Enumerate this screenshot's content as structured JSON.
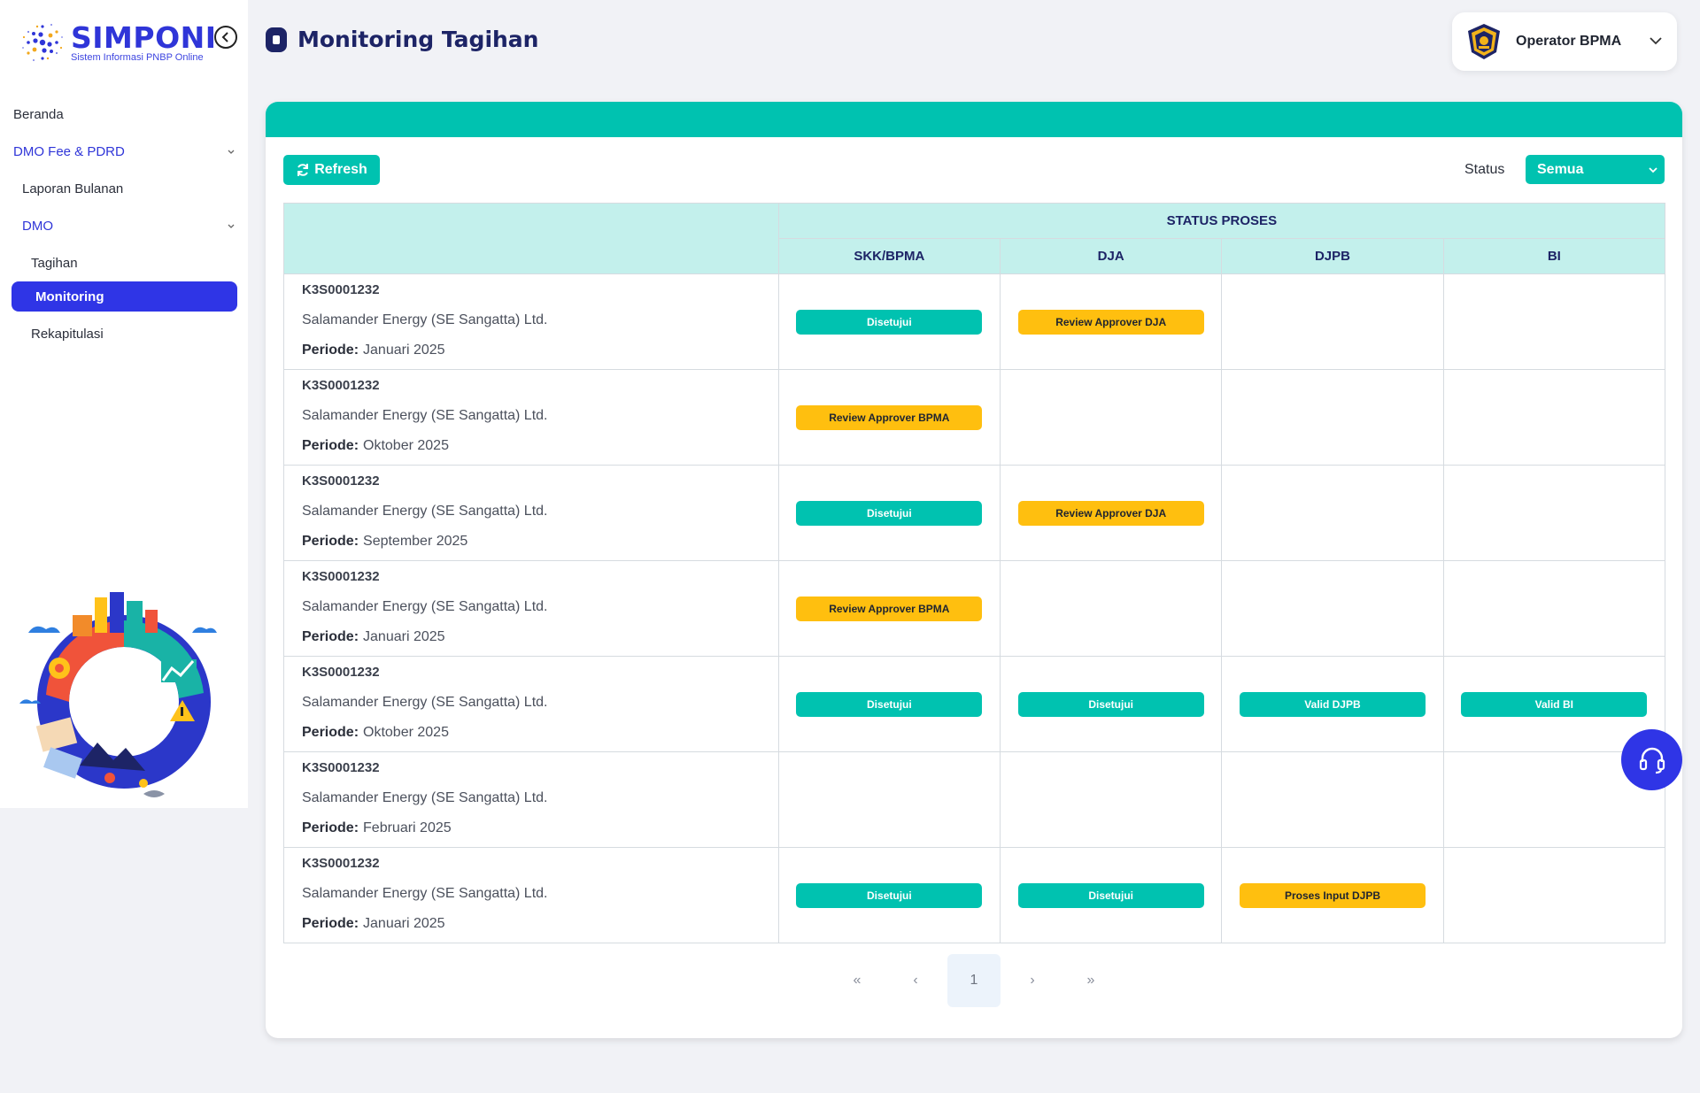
{
  "app": {
    "name": "SIMPONI",
    "tagline": "Sistem Informasi PNBP Online"
  },
  "sidebar": {
    "items": [
      {
        "label": "Beranda"
      },
      {
        "label": "DMO Fee & PDRD"
      },
      {
        "label": "Laporan Bulanan"
      },
      {
        "label": "DMO"
      },
      {
        "label": "Tagihan"
      },
      {
        "label": "Monitoring"
      },
      {
        "label": "Rekapitulasi"
      }
    ]
  },
  "header": {
    "title": "Monitoring Tagihan",
    "user": "Operator BPMA"
  },
  "toolbar": {
    "refresh_label": "Refresh",
    "status_label": "Status",
    "status_value": "Semua"
  },
  "table": {
    "group_header": "STATUS PROSES",
    "columns": [
      "SKK/BPMA",
      "DJA",
      "DJPB",
      "BI"
    ],
    "period_label": "Periode:",
    "rows": [
      {
        "code": "K3S0001232",
        "company": "Salamander Energy (SE Sangatta) Ltd.",
        "period": "Januari 2025",
        "statuses": [
          {
            "text": "Disetujui",
            "color": "green"
          },
          {
            "text": "Review Approver DJA",
            "color": "yellow"
          },
          null,
          null
        ]
      },
      {
        "code": "K3S0001232",
        "company": "Salamander Energy (SE Sangatta) Ltd.",
        "period": "Oktober 2025",
        "statuses": [
          {
            "text": "Review Approver BPMA",
            "color": "yellow"
          },
          null,
          null,
          null
        ]
      },
      {
        "code": "K3S0001232",
        "company": "Salamander Energy (SE Sangatta) Ltd.",
        "period": "September 2025",
        "statuses": [
          {
            "text": "Disetujui",
            "color": "green"
          },
          {
            "text": "Review Approver DJA",
            "color": "yellow"
          },
          null,
          null
        ]
      },
      {
        "code": "K3S0001232",
        "company": "Salamander Energy (SE Sangatta) Ltd.",
        "period": "Januari 2025",
        "statuses": [
          {
            "text": "Review Approver BPMA",
            "color": "yellow"
          },
          null,
          null,
          null
        ]
      },
      {
        "code": "K3S0001232",
        "company": "Salamander Energy (SE Sangatta) Ltd.",
        "period": "Oktober 2025",
        "statuses": [
          {
            "text": "Disetujui",
            "color": "green"
          },
          {
            "text": "Disetujui",
            "color": "green"
          },
          {
            "text": "Valid DJPB",
            "color": "green"
          },
          {
            "text": "Valid BI",
            "color": "green"
          }
        ]
      },
      {
        "code": "K3S0001232",
        "company": "Salamander Energy (SE Sangatta) Ltd.",
        "period": "Februari 2025",
        "statuses": [
          null,
          null,
          null,
          null
        ]
      },
      {
        "code": "K3S0001232",
        "company": "Salamander Energy (SE Sangatta) Ltd.",
        "period": "Januari 2025",
        "statuses": [
          {
            "text": "Disetujui",
            "color": "green"
          },
          {
            "text": "Disetujui",
            "color": "green"
          },
          {
            "text": "Proses Input DJPB",
            "color": "yellow"
          },
          null
        ]
      }
    ]
  },
  "pagination": {
    "first": "«",
    "prev": "‹",
    "current": "1",
    "next": "›",
    "last": "»"
  },
  "colors": {
    "brand": "#2f35e6",
    "accent": "#00c2b0",
    "warning": "#ffbf0f",
    "header_bg": "#c3f0ec",
    "title": "#1d2466"
  },
  "icons": [
    "simponi-logo-icon",
    "collapse-sidebar-icon",
    "chevron-down-icon",
    "clipboard-icon",
    "kemenkeu-emblem-icon",
    "refresh-icon",
    "headset-icon"
  ]
}
